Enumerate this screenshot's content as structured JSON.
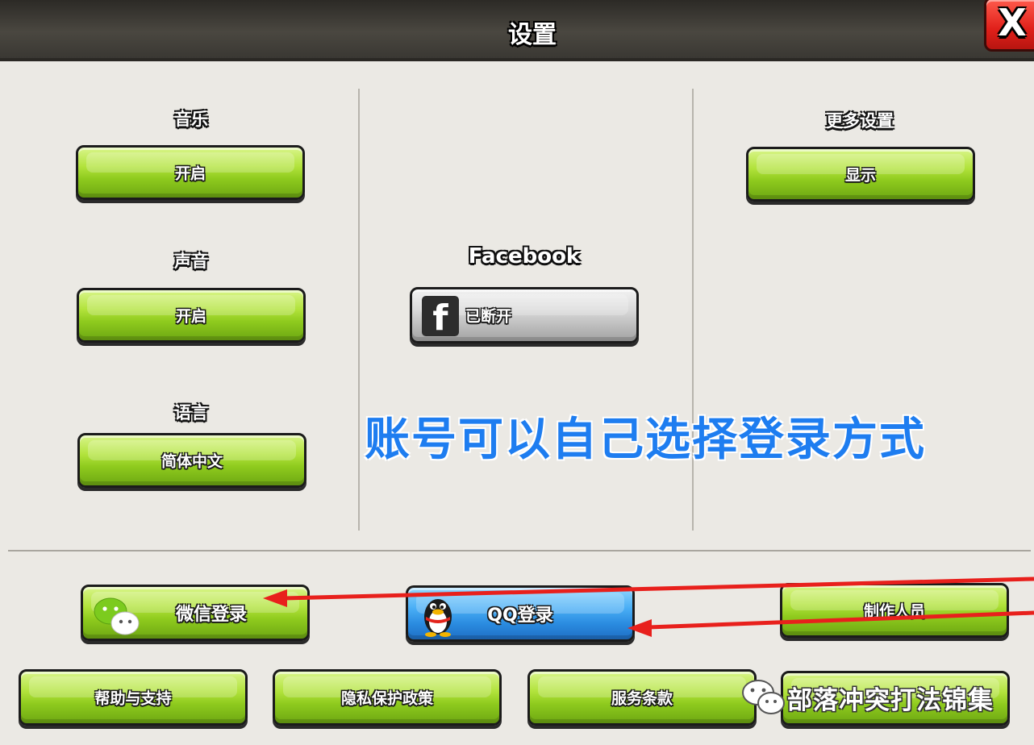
{
  "window": {
    "title": "设置",
    "close_label": "X"
  },
  "left_column": {
    "music": {
      "label": "音乐",
      "button": "开启"
    },
    "sound": {
      "label": "声音",
      "button": "开启"
    },
    "language": {
      "label": "语言",
      "button": "简体中文"
    }
  },
  "center_column": {
    "facebook": {
      "label": "Facebook",
      "button": "已断开",
      "icon": "f"
    }
  },
  "right_column": {
    "more_settings": {
      "label": "更多设置",
      "button": "显示"
    }
  },
  "bottom_row1": {
    "wechat_login": "微信登录",
    "qq_login": "QQ登录",
    "credits": "制作人员"
  },
  "bottom_row2": {
    "help_support": "帮助与支持",
    "privacy_policy": "隐私保护政策",
    "terms_of_service": "服务条款"
  },
  "overlay": {
    "annotation": "账号可以自己选择登录方式",
    "watermark": "部落冲突打法锦集"
  },
  "colors": {
    "green_button": "#9bd42a",
    "blue_button": "#2a8be0",
    "annotation_text": "#1e7df0",
    "arrow": "#e8201c",
    "close_button": "#e0201a"
  }
}
